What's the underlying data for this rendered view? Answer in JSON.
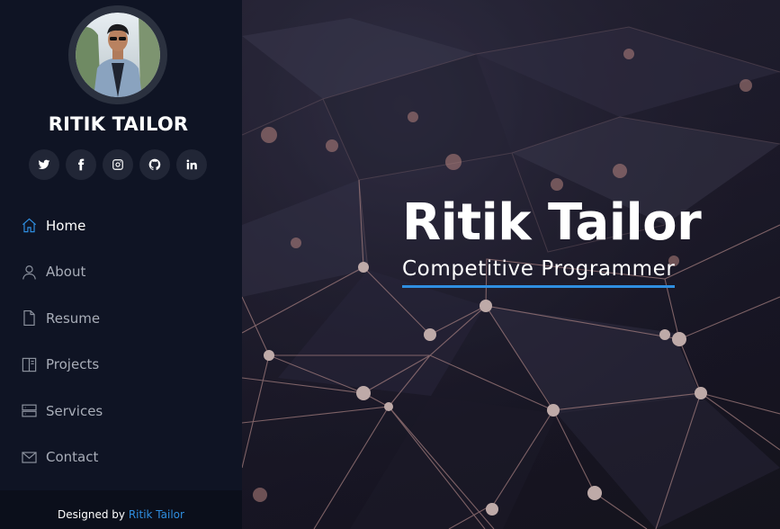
{
  "profile": {
    "name": "RITIK TAILOR"
  },
  "socials": [
    {
      "icon": "twitter-icon"
    },
    {
      "icon": "facebook-icon"
    },
    {
      "icon": "instagram-icon"
    },
    {
      "icon": "github-icon"
    },
    {
      "icon": "linkedin-icon"
    }
  ],
  "nav": {
    "items": [
      {
        "label": "Home",
        "icon": "home-icon",
        "active": true
      },
      {
        "label": "About",
        "icon": "user-icon"
      },
      {
        "label": "Resume",
        "icon": "file-icon"
      },
      {
        "label": "Projects",
        "icon": "book-icon"
      },
      {
        "label": "Services",
        "icon": "server-icon"
      },
      {
        "label": "Contact",
        "icon": "envelope-icon"
      }
    ]
  },
  "footer": {
    "prefix": "Designed by",
    "author": "Ritik Tailor"
  },
  "hero": {
    "title": "Ritik Tailor",
    "subtitle": "Competitive Programmer"
  },
  "colors": {
    "accent": "#2f8ee0",
    "sidebar_bg": "#0f1424"
  }
}
